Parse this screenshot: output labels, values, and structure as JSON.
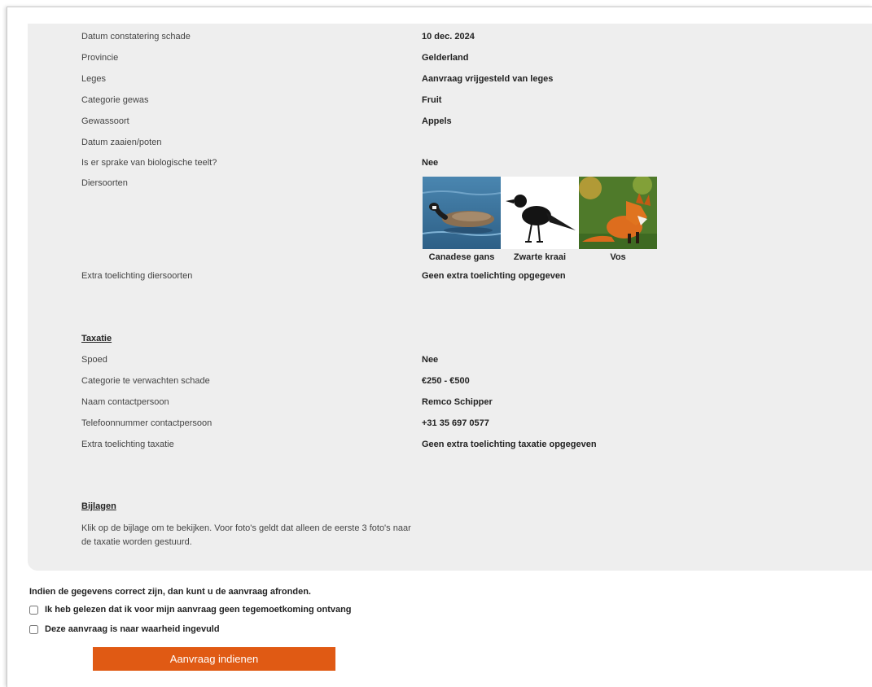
{
  "summary": {
    "rows": [
      {
        "label": "Datum constatering schade",
        "value": "10 dec. 2024"
      },
      {
        "label": "Provincie",
        "value": "Gelderland"
      },
      {
        "label": "Leges",
        "value": "Aanvraag vrijgesteld van leges"
      },
      {
        "label": "Categorie gewas",
        "value": "Fruit"
      },
      {
        "label": "Gewassoort",
        "value": "Appels"
      },
      {
        "label": "Datum zaaien/poten",
        "value": ""
      },
      {
        "label": "Is er sprake van biologische teelt?",
        "value": "Nee"
      },
      {
        "label": "Diersoorten",
        "value": ""
      }
    ],
    "animals": [
      {
        "name": "Canadese gans",
        "icon": "canada-goose-photo"
      },
      {
        "name": "Zwarte kraai",
        "icon": "carrion-crow-photo"
      },
      {
        "name": "Vos",
        "icon": "fox-photo"
      }
    ],
    "extra_animals": {
      "label": "Extra toelichting diersoorten",
      "value": "Geen extra toelichting opgegeven"
    }
  },
  "taxatie": {
    "heading": "Taxatie",
    "rows": [
      {
        "label": "Spoed",
        "value": "Nee"
      },
      {
        "label": "Categorie te verwachten schade",
        "value": "€250 - €500"
      },
      {
        "label": "Naam contactpersoon",
        "value": "Remco Schipper"
      },
      {
        "label": "Telefoonnummer contactpersoon",
        "value": "+31 35 697 0577"
      },
      {
        "label": "Extra toelichting taxatie",
        "value": "Geen extra toelichting taxatie opgegeven"
      }
    ]
  },
  "bijlagen": {
    "heading": "Bijlagen",
    "text": "Klik op de bijlage om te bekijken. Voor foto's geldt dat alleen de eerste 3 foto's naar de taxatie worden gestuurd."
  },
  "confirm": {
    "intro": "Indien de gegevens correct zijn, dan kunt u de aanvraag afronden.",
    "check1": "Ik heb gelezen dat ik voor mijn aanvraag geen tegemoetkoming ontvang",
    "check2": "Deze aanvraag is naar waarheid ingevuld",
    "submit": "Aanvraag indienen"
  },
  "colors": {
    "panel": "#eeeeee",
    "accent": "#e05a14"
  }
}
